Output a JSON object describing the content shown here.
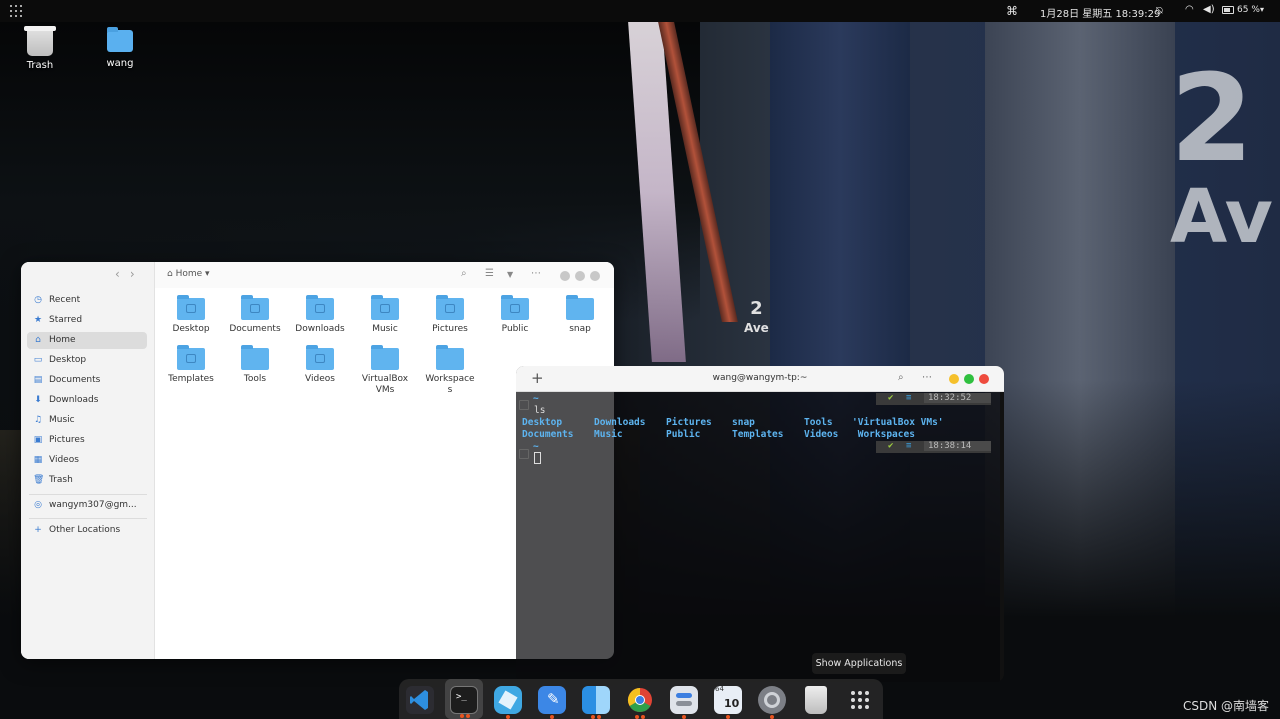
{
  "topbar": {
    "activities_icon": "apps-grid-icon",
    "command_icon": "⌘",
    "clock": "1月28日 星期五  18:39:29",
    "battery_pct": "65 %",
    "icons": [
      "notifications-off-icon",
      "wifi-icon",
      "volume-icon",
      "battery-icon",
      "chevron-down-icon"
    ]
  },
  "desktop": {
    "icons": [
      {
        "label": "Trash",
        "icon": "trash-icon"
      },
      {
        "label": "wang",
        "icon": "home-folder-icon"
      }
    ]
  },
  "files": {
    "breadcrumb": "Home",
    "sidebar": [
      {
        "label": "Recent",
        "icon": "clock-icon"
      },
      {
        "label": "Starred",
        "icon": "star-icon"
      },
      {
        "label": "Home",
        "icon": "home-icon",
        "active": true
      },
      {
        "label": "Desktop",
        "icon": "desktop-icon"
      },
      {
        "label": "Documents",
        "icon": "document-icon"
      },
      {
        "label": "Downloads",
        "icon": "download-icon"
      },
      {
        "label": "Music",
        "icon": "music-icon"
      },
      {
        "label": "Pictures",
        "icon": "picture-icon"
      },
      {
        "label": "Videos",
        "icon": "video-icon"
      },
      {
        "label": "Trash",
        "icon": "trash-icon"
      },
      {
        "label": "wangym307@gm...",
        "icon": "network-drive-icon"
      },
      {
        "label": "Other Locations",
        "icon": "plus-icon"
      }
    ],
    "folders": [
      "Desktop",
      "Documents",
      "Downloads",
      "Music",
      "Pictures",
      "Public",
      "snap",
      "Templates",
      "Tools",
      "Videos",
      "VirtualBox VMs",
      "Workspace s"
    ]
  },
  "terminal": {
    "title": "wang@wangym-tp:~",
    "prompt_dir": "~",
    "command": "ls",
    "status1": {
      "check": "✔",
      "eq": "≡",
      "time": "18:32:52"
    },
    "status2": {
      "check": "✔",
      "eq": "≡",
      "time": "18:38:14"
    },
    "ls_row1": [
      "Desktop",
      "Downloads",
      "Pictures",
      "snap",
      "Tools",
      "'VirtualBox VMs'"
    ],
    "ls_row2": [
      "Documents",
      "Music",
      "Public",
      "Templates",
      "Videos",
      " Workspaces"
    ],
    "prompt_dir2": "~"
  },
  "tooltip": "Show Applications",
  "dock": [
    "vscode-icon",
    "terminal-icon",
    "virtualbox-icon",
    "editor-icon",
    "finder-icon",
    "chrome-icon",
    "settings-toggle-icon",
    "software-updater-icon",
    "system-settings-icon",
    "trash-icon",
    "show-applications-icon"
  ],
  "watermark": "CSDN @南墙客"
}
